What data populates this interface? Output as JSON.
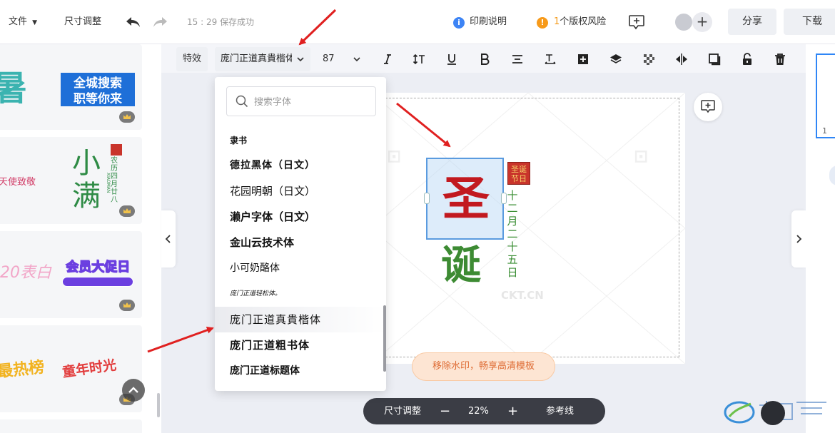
{
  "topbar": {
    "file_menu": "文件",
    "resize": "尺寸调整",
    "save_status": "15 : 29 保存成功",
    "print_help": "印刷说明",
    "risk_count": "1",
    "risk_text": "个版权风险",
    "share": "分享",
    "download": "下载"
  },
  "toolbar": {
    "effects": "特效",
    "font_name": "庞门正道真貴楷体",
    "font_size": "87"
  },
  "font_dropdown": {
    "search_placeholder": "搜索字体",
    "fonts": [
      "隶书",
      "德拉黑体（日文）",
      "花园明朝（日文）",
      "濑户字体（日文）",
      "金山云技术体",
      "小可奶酪体",
      "庞门正道轻松体。",
      "庞门正道真貴楷体",
      "庞门正道粗书体",
      "庞门正道标题体"
    ],
    "selected_index": 7
  },
  "canvas": {
    "char_top": "圣",
    "char_bottom": "诞",
    "stamp": "圣诞节日",
    "vertical_date": "十二月二十五日",
    "watermark": "CKT.CN",
    "promo": "移除水印，畅享高清模板"
  },
  "zoom_bar": {
    "resize": "尺寸调整",
    "minus": "−",
    "zoom": "22%",
    "plus": "+",
    "guides": "参考线"
  },
  "templates": {
    "t1": "暑",
    "t2_line1": "全城搜索",
    "t2_line2": "职等你来",
    "t3": "天使致敬",
    "t4_big1": "小",
    "t4_big2": "满",
    "t4_side": "农历四月廿八",
    "t4_latin": "XIAOMAN",
    "t5": "20表白",
    "t6": "会员大促日",
    "t7": "最热榜",
    "t8": "童年时光"
  },
  "right_panel": {
    "page_number": "1"
  },
  "colors": {
    "accent_blue": "#2f86f6",
    "warning_orange": "#f39a1a",
    "red_char": "#c2191f",
    "green_char": "#3d8b33",
    "annotation_red": "#e02020"
  }
}
